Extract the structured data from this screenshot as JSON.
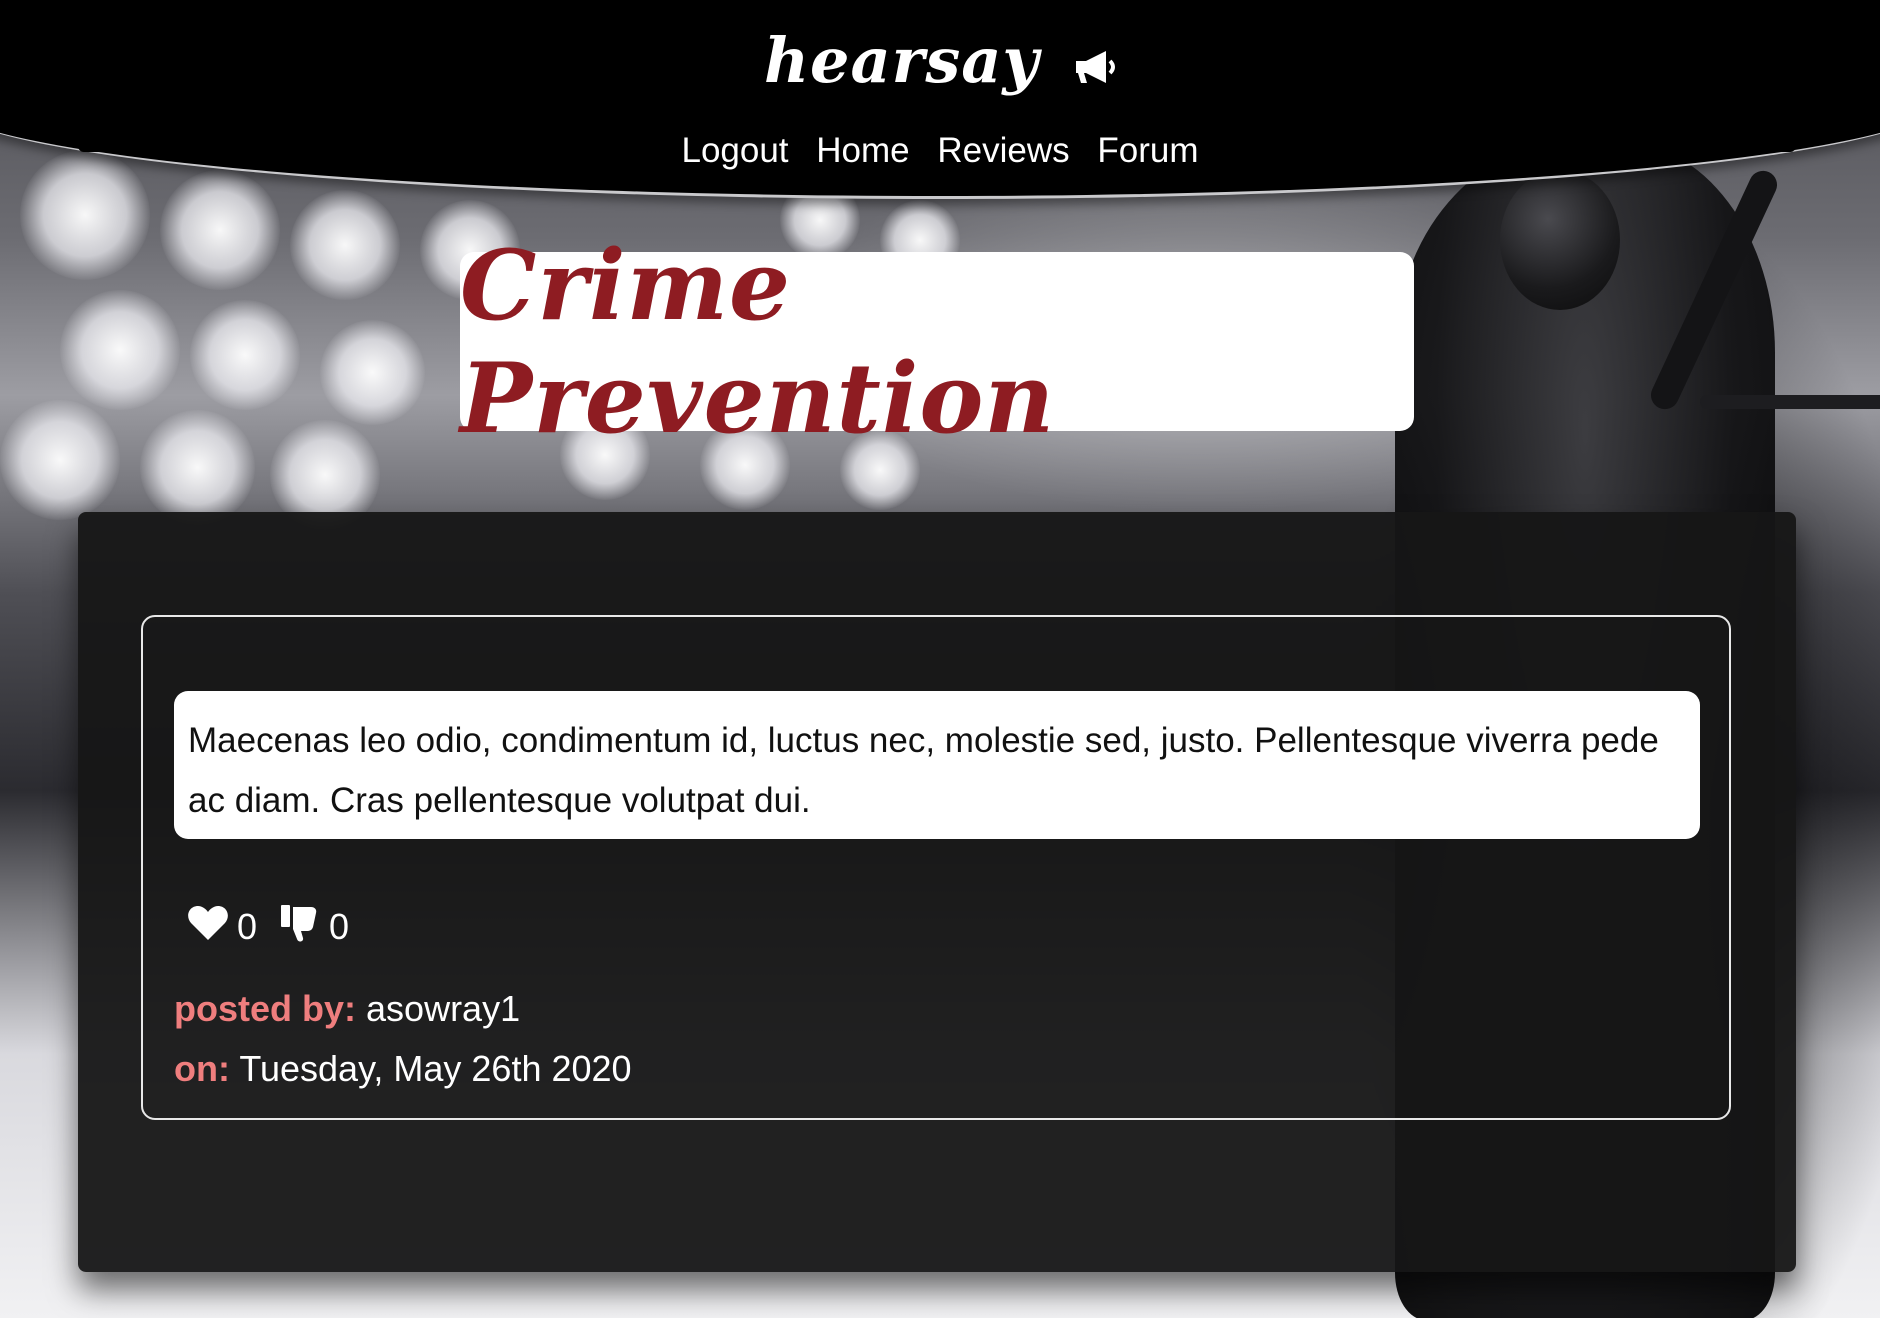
{
  "header": {
    "logo_text": "hearsay",
    "nav": [
      {
        "label": "Logout"
      },
      {
        "label": "Home"
      },
      {
        "label": "Reviews"
      },
      {
        "label": "Forum"
      }
    ]
  },
  "page": {
    "title": "Crime Prevention"
  },
  "post": {
    "body": "Maecenas leo odio, condimentum id, luctus nec, molestie sed, justo. Pellentesque viverra pede ac diam. Cras pellentesque volutpat dui.",
    "likes": "0",
    "dislikes": "0",
    "posted_by_label": "posted by:",
    "author": "asowray1",
    "on_label": "on:",
    "date": "Tuesday, May 26th 2020"
  },
  "icons": {
    "logo_icon": "megaphone-icon",
    "like_icon": "heart-icon",
    "dislike_icon": "thumbs-down-icon"
  },
  "colors": {
    "title": "#8e1c22",
    "meta_label": "#ef7e7e",
    "header": "#000000",
    "panel": "#161616"
  }
}
